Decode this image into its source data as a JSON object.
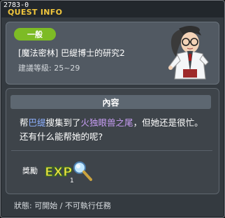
{
  "window": {
    "quest_id": "2783-0",
    "title": "QUEST INFO"
  },
  "quest": {
    "category_badge": "一般",
    "name": "[魔法密林] 巴缇博士的研究2",
    "level_requirement": "建議等級: 25~29"
  },
  "content": {
    "header": "內容",
    "text_parts": {
      "p1": "帮",
      "npc_name": "巴缇",
      "p2": "搜集到了",
      "item_name": "火独眼兽之尾",
      "p3": "，但她还是很忙。还有什么能帮她的呢?"
    }
  },
  "reward": {
    "label": "獎勵",
    "exp_text": "EXP",
    "exp_amount": "1"
  },
  "status": {
    "text": "狀態: 可開始 / 不可執行任務"
  },
  "icons": {
    "npc": "doctor-npc-icon",
    "exp": "exp-magnifier-icon"
  },
  "colors": {
    "title": "#f0c63d",
    "badge": "#7dbb25",
    "npc_highlight": "#8db0ff",
    "item_highlight": "#c79cf3"
  }
}
